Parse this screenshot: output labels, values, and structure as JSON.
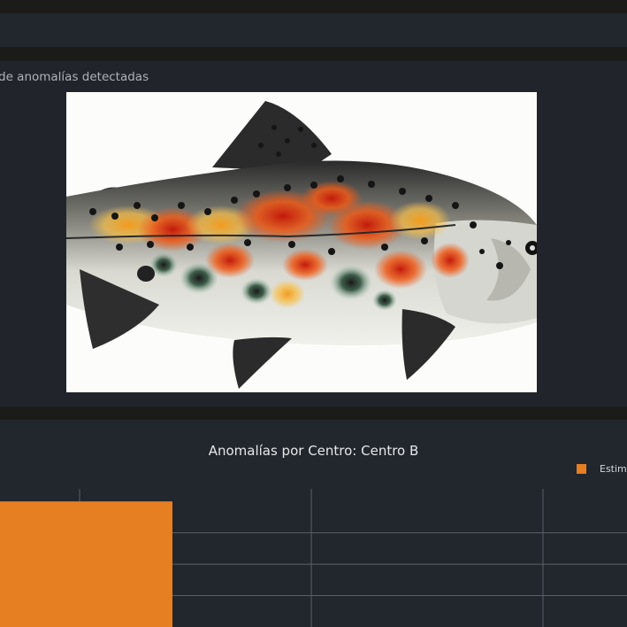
{
  "panels": {
    "image_panel_title": "de anomalías detectadas"
  },
  "chart_data": {
    "type": "bar",
    "title": "Anomalías por Centro: Centro B",
    "series": [
      {
        "name": "Estim",
        "color": "#e67e22",
        "values": [
          4
        ]
      }
    ],
    "categories": [
      ""
    ],
    "ylim": [
      0,
      4.4
    ],
    "grid": true,
    "legend_position": "top-right"
  },
  "colors": {
    "bar": "#e67e22",
    "panel_bg": "#22262d",
    "gridline": "#5b5f66"
  }
}
